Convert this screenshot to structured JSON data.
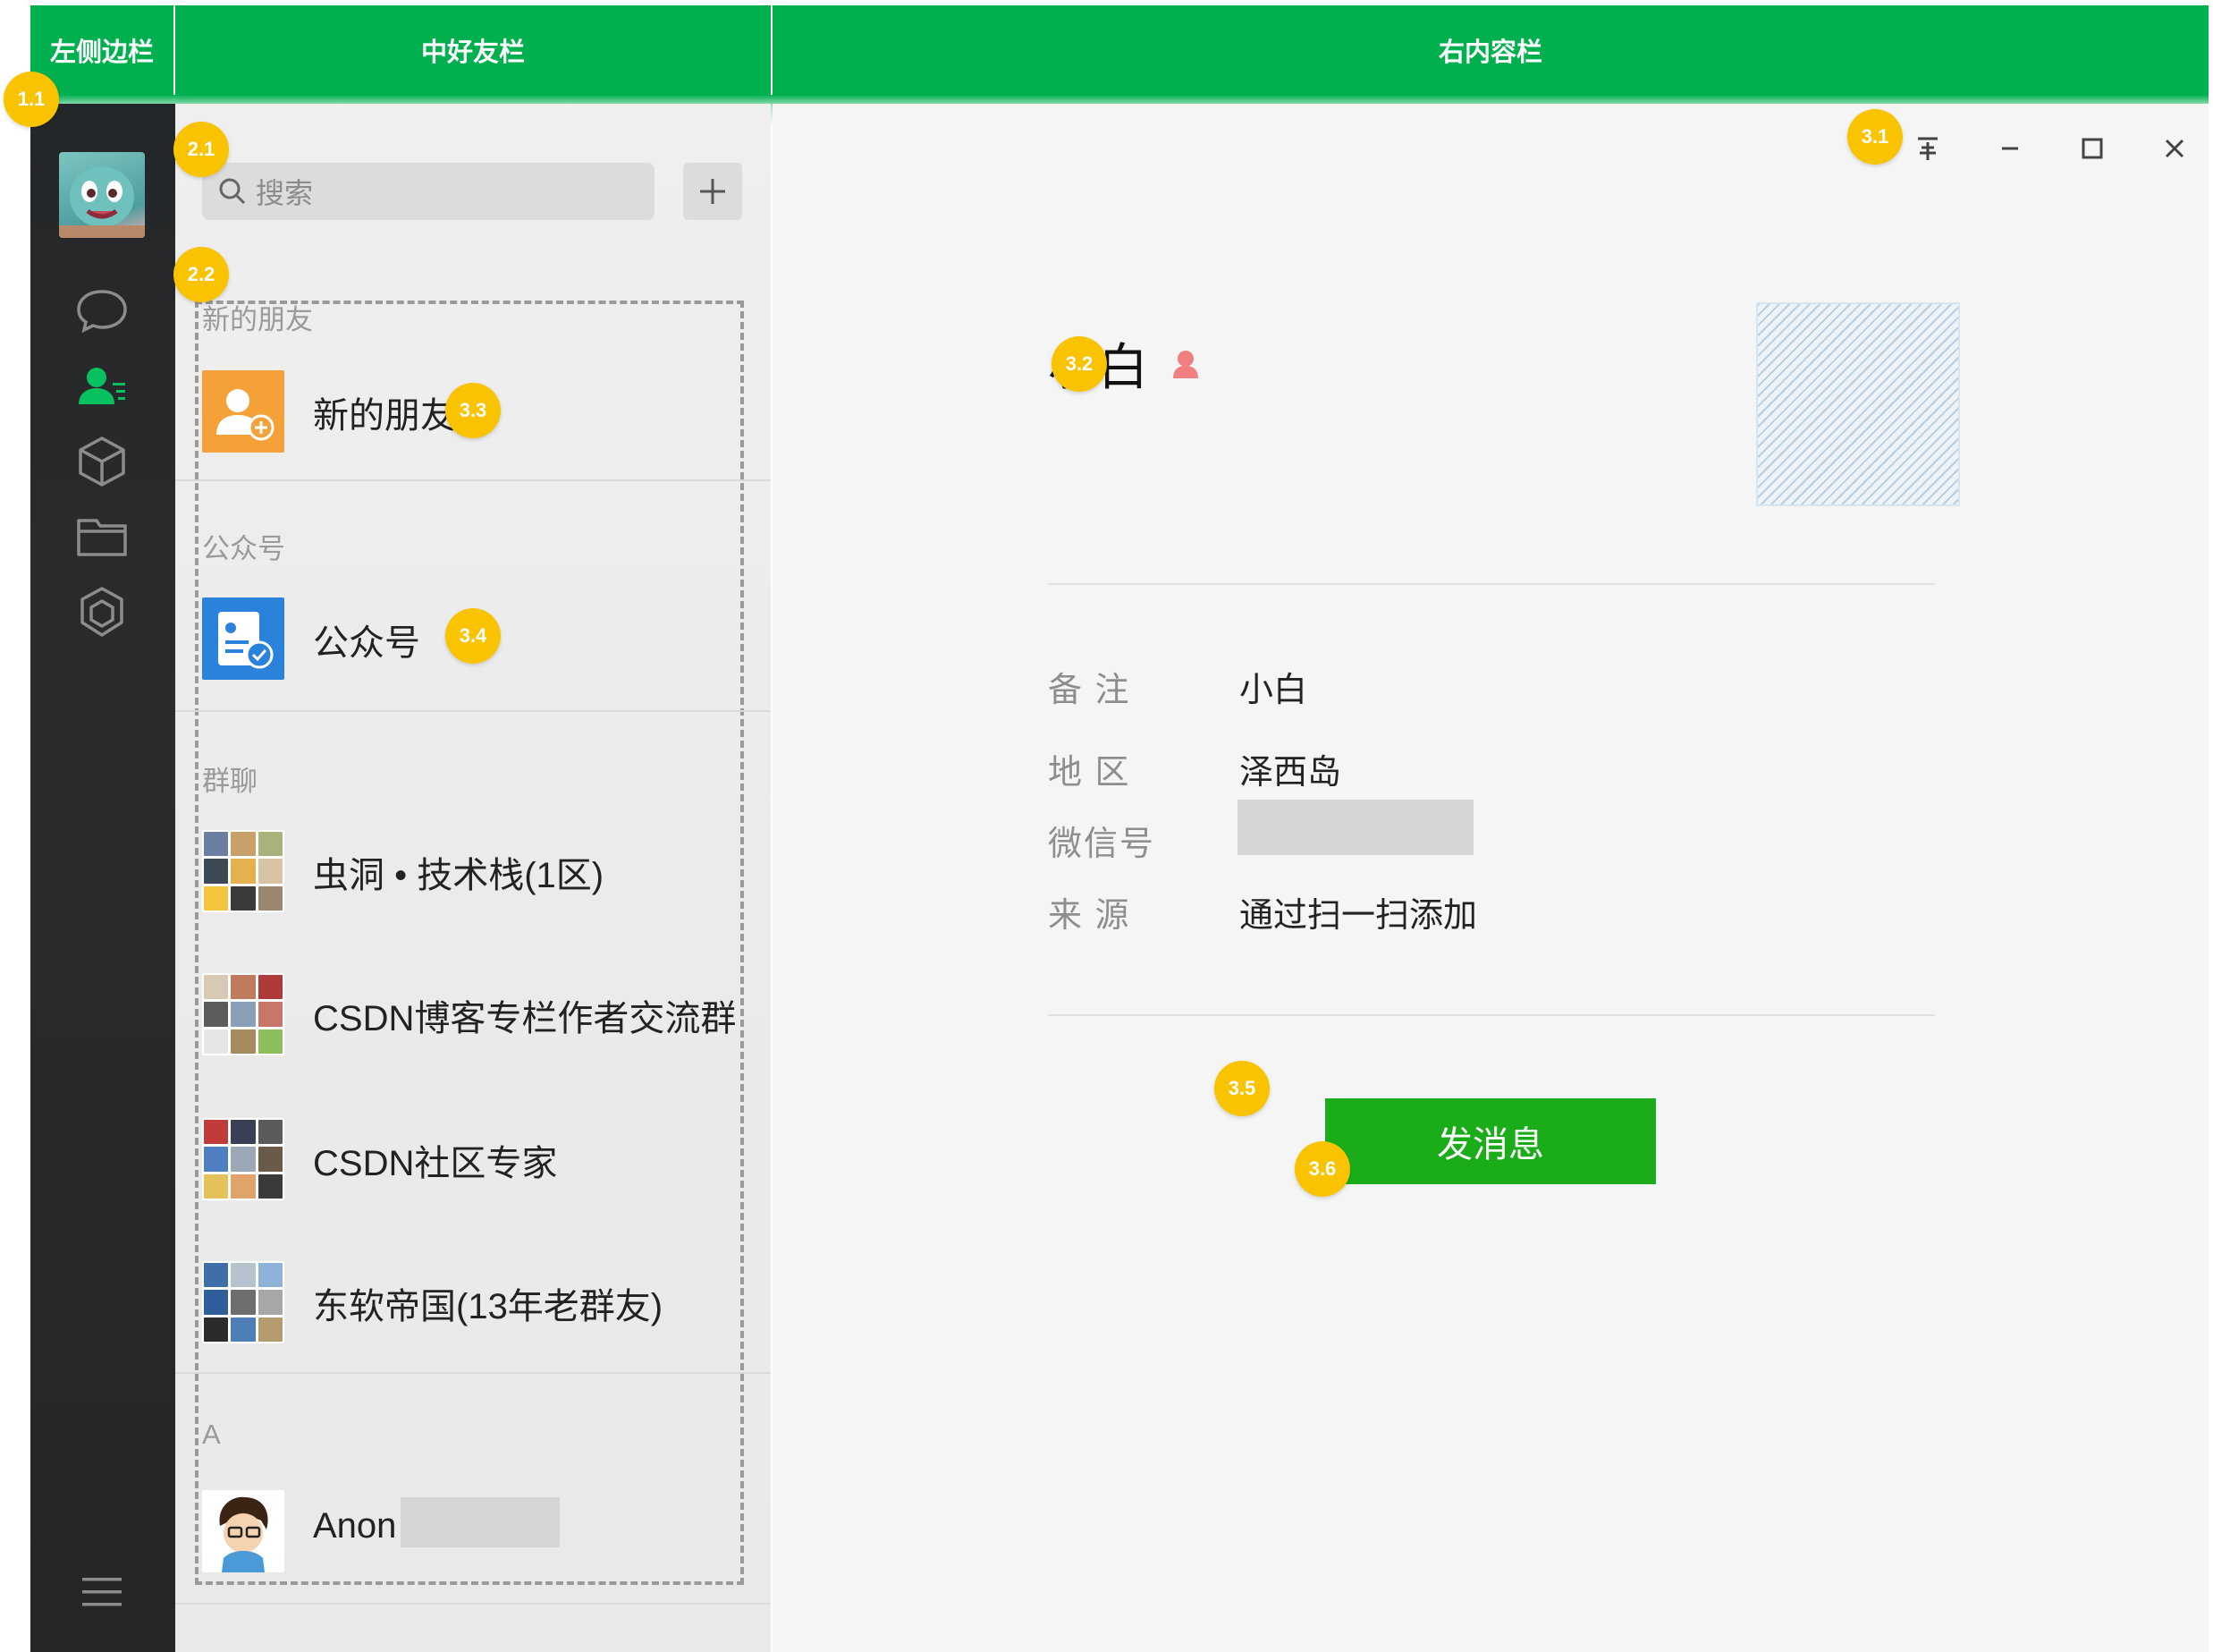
{
  "header": {
    "left_label": "左侧边栏",
    "middle_label": "中好友栏",
    "right_label": "右内容栏",
    "color": "#00b04f"
  },
  "sidebar": {
    "icons": [
      "chat-icon",
      "contacts-icon",
      "box-icon",
      "folder-icon",
      "settings-icon",
      "menu-icon"
    ],
    "active": "contacts-icon",
    "active_color": "#07c160"
  },
  "friends": {
    "search_placeholder": "搜索",
    "add_button": "+",
    "sections": {
      "new_friends": "新的朋友",
      "official": "公众号",
      "groups": "群聊",
      "a": "A"
    },
    "new_friends_item": "新的朋友",
    "official_item": "公众号",
    "groups": [
      "虫洞 • 技术栈(1区)",
      "CSDN博客专栏作者交流群",
      "CSDN社区专家",
      "东软帝国(13年老群友)"
    ],
    "contacts": [
      "Anon"
    ]
  },
  "window": {
    "pin": "⊼",
    "minimize": "−",
    "maximize": "☐",
    "close": "✕"
  },
  "profile": {
    "name": "小白",
    "fields": [
      {
        "label": "备  注",
        "value": "小白"
      },
      {
        "label": "地  区",
        "value": "泽西岛"
      },
      {
        "label": "微信号",
        "value": ""
      },
      {
        "label": "来  源",
        "value": "通过扫一扫添加"
      }
    ],
    "send_button": "发消息"
  },
  "markers": [
    "1.1",
    "2.1",
    "2.2",
    "3.1",
    "3.2",
    "3.3",
    "3.4",
    "3.5",
    "3.6"
  ],
  "colors": {
    "marker": "#f9c300",
    "send_button": "#1aad19",
    "new_friend_icon": "#f5a13a",
    "official_icon": "#2b82db"
  }
}
